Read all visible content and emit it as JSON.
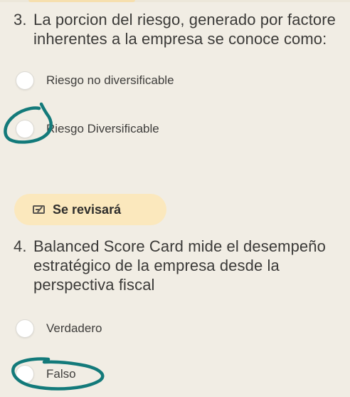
{
  "question3": {
    "number": "3.",
    "line1": "La porcion del riesgo, generado por factore",
    "line2": "inherentes a la empresa se conoce como:",
    "options": [
      {
        "label": "Riesgo no diversificable"
      },
      {
        "label": "Riesgo Diversificable"
      }
    ]
  },
  "review_badge": {
    "icon": "edit-pencil-icon",
    "label": "Se revisará",
    "color": "#fbe8bd"
  },
  "question4": {
    "number": "4.",
    "line1": "Balanced Score Card mide el desempeño",
    "line2": "estratégico de la empresa desde la",
    "line3": "perspectiva fiscal",
    "options": [
      {
        "label": "Verdadero"
      },
      {
        "label": "Falso"
      }
    ]
  },
  "annotation_color": "#137a7a"
}
